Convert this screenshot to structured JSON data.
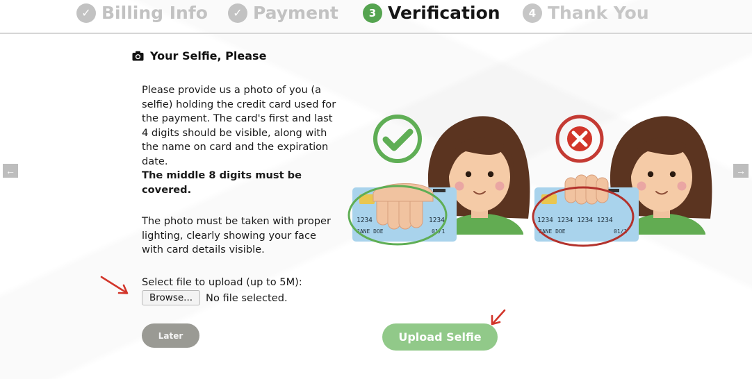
{
  "steps": [
    {
      "label": "Billing Info",
      "marker": "✓",
      "state": "done"
    },
    {
      "label": "Payment",
      "marker": "✓",
      "state": "done"
    },
    {
      "label": "Verification",
      "marker": "3",
      "state": "active"
    },
    {
      "label": "Thank You",
      "marker": "4",
      "state": "todo"
    }
  ],
  "section": {
    "title": "Your Selfie, Please",
    "icon": "camera-icon"
  },
  "instructions": {
    "paragraph1": "Please provide us a photo of you (a selfie) holding the credit card used for the payment. The card's first and last 4 digits should be visible, along with the name on card and the expiration date.",
    "paragraph1_bold": "The middle 8 digits must be covered.",
    "paragraph2": "The photo must be taken with proper lighting, clearly showing your face with card details visible."
  },
  "upload": {
    "label": "Select file to upload (up to 5M):",
    "browse_label": "Browse...",
    "status": "No file selected."
  },
  "buttons": {
    "later": "Later",
    "upload_selfie": "Upload Selfie"
  },
  "illustration": {
    "good": {
      "card_digits": "1234 1234",
      "name": "JANE DOE",
      "expiry": "01/1"
    },
    "bad": {
      "card_digits": "1234 1234 1234 1234",
      "name": "JANE DOE",
      "expiry": "01/1"
    }
  },
  "colors": {
    "accent_green": "#55a450",
    "upload_button": "#91c989",
    "later_button": "#9a9a94",
    "step_inactive": "#c2c2c2",
    "annotation_red": "#d2352a"
  }
}
